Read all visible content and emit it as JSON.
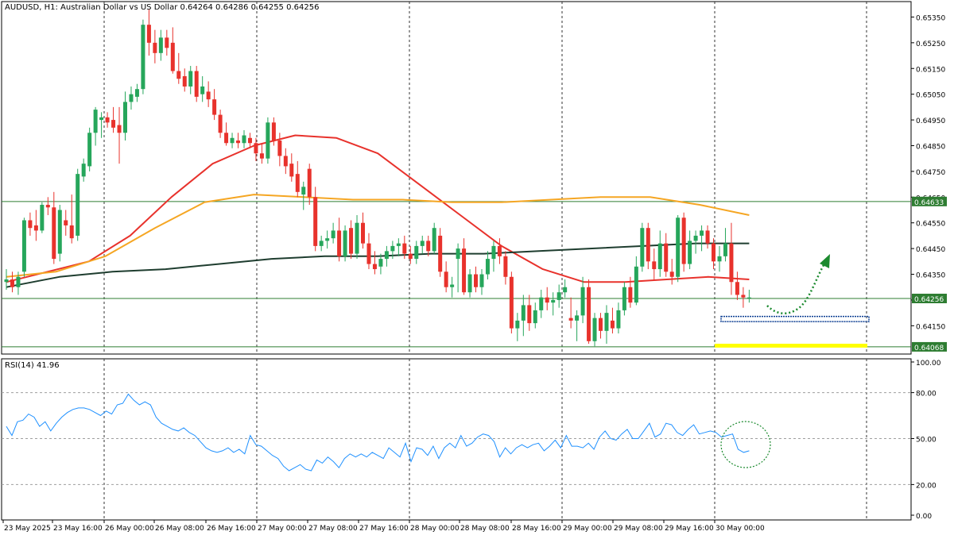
{
  "header": {
    "symbol_line": "AUDUSD, H1:  Australian Dollar vs US Dollar  0.64264 0.64286 0.64255 0.64256"
  },
  "rsi_panel": {
    "title": "RSI(14) 41.96"
  },
  "colors": {
    "bull": "#26a65b",
    "bear": "#e8322c",
    "ma_red": "#e8322c",
    "ma_orange": "#f5a623",
    "ma_dark": "#1e3d2f",
    "level_line": "#2e7d32",
    "rsi_line": "#1e90ff",
    "highlight": "#ffff00",
    "arrow": "#1b8a2e",
    "grid": "#9e9e9e"
  },
  "chart_data": [
    {
      "type": "candlestick",
      "title": "AUDUSD, H1:  Australian Dollar vs US Dollar  0.64264 0.64286 0.64255 0.64256",
      "ylim": [
        0.6404,
        0.6541
      ],
      "y_ticks": [
        "0.65350",
        "0.65250",
        "0.65150",
        "0.65050",
        "0.64950",
        "0.64850",
        "0.64750",
        "0.64650",
        "0.64550",
        "0.64450",
        "0.64350",
        "0.64250",
        "0.64150"
      ],
      "x_tick_labels": [
        "23 May 2025",
        "23 May 16:00",
        "26 May 00:00",
        "26 May 08:00",
        "26 May 16:00",
        "27 May 00:00",
        "27 May 08:00",
        "27 May 16:00",
        "28 May 00:00",
        "28 May 08:00",
        "28 May 16:00",
        "29 May 00:00",
        "29 May 08:00",
        "29 May 16:00",
        "30 May 00:00"
      ],
      "price_labels": [
        {
          "value": "0.64633",
          "color": "#2e7d32"
        },
        {
          "value": "0.64256",
          "color": "#2e7d32"
        },
        {
          "value": "0.64068",
          "color": "#2e7d32"
        }
      ],
      "horizontal_levels": [
        0.64633,
        0.64256,
        0.64068
      ],
      "period_separators": [
        "26 May 00:00",
        "27 May 00:00",
        "28 May 00:00",
        "29 May 00:00",
        "30 May 00:00",
        "31 May 00:00"
      ],
      "ohlc": [
        [
          0.6432,
          0.6437,
          0.6429,
          0.6433
        ],
        [
          0.6433,
          0.6436,
          0.6428,
          0.643
        ],
        [
          0.643,
          0.6436,
          0.6427,
          0.6434
        ],
        [
          0.6436,
          0.6457,
          0.6434,
          0.6456
        ],
        [
          0.6456,
          0.6459,
          0.645,
          0.6453
        ],
        [
          0.6454,
          0.646,
          0.6448,
          0.6452
        ],
        [
          0.6452,
          0.6463,
          0.6451,
          0.6462
        ],
        [
          0.6462,
          0.6465,
          0.6458,
          0.6461
        ],
        [
          0.6461,
          0.6467,
          0.6439,
          0.6441
        ],
        [
          0.6443,
          0.6462,
          0.644,
          0.646
        ],
        [
          0.6456,
          0.646,
          0.645,
          0.6454
        ],
        [
          0.6454,
          0.6466,
          0.6447,
          0.6449
        ],
        [
          0.645,
          0.6476,
          0.6448,
          0.6474
        ],
        [
          0.6473,
          0.648,
          0.6471,
          0.6478
        ],
        [
          0.6477,
          0.6492,
          0.6475,
          0.649
        ],
        [
          0.649,
          0.65,
          0.6485,
          0.6499
        ],
        [
          0.6495,
          0.6498,
          0.6488,
          0.6496
        ],
        [
          0.6496,
          0.6498,
          0.6492,
          0.6494
        ],
        [
          0.6495,
          0.65,
          0.649,
          0.6492
        ],
        [
          0.6493,
          0.65,
          0.6478,
          0.649
        ],
        [
          0.649,
          0.6506,
          0.6487,
          0.6502
        ],
        [
          0.6502,
          0.6508,
          0.6499,
          0.6505
        ],
        [
          0.6504,
          0.6509,
          0.6502,
          0.6507
        ],
        [
          0.6507,
          0.6534,
          0.6505,
          0.6532
        ],
        [
          0.6532,
          0.6538,
          0.652,
          0.6525
        ],
        [
          0.6525,
          0.653,
          0.6517,
          0.6521
        ],
        [
          0.6521,
          0.653,
          0.6518,
          0.6527
        ],
        [
          0.6527,
          0.653,
          0.652,
          0.6523
        ],
        [
          0.6525,
          0.6531,
          0.6513,
          0.6514
        ],
        [
          0.6514,
          0.6521,
          0.6509,
          0.6511
        ],
        [
          0.6512,
          0.6515,
          0.6506,
          0.6508
        ],
        [
          0.6508,
          0.6516,
          0.6505,
          0.6514
        ],
        [
          0.6514,
          0.6516,
          0.6502,
          0.6504
        ],
        [
          0.6505,
          0.6512,
          0.6502,
          0.6508
        ],
        [
          0.6506,
          0.651,
          0.65,
          0.6503
        ],
        [
          0.6503,
          0.6507,
          0.6495,
          0.6497
        ],
        [
          0.6497,
          0.6499,
          0.6488,
          0.649
        ],
        [
          0.649,
          0.6494,
          0.6485,
          0.6486
        ],
        [
          0.6486,
          0.649,
          0.6484,
          0.6488
        ],
        [
          0.6487,
          0.649,
          0.6484,
          0.6486
        ],
        [
          0.6486,
          0.6491,
          0.6484,
          0.6489
        ],
        [
          0.6488,
          0.649,
          0.6484,
          0.6486
        ],
        [
          0.6486,
          0.6488,
          0.6479,
          0.6482
        ],
        [
          0.6482,
          0.6486,
          0.6478,
          0.648
        ],
        [
          0.648,
          0.6496,
          0.6478,
          0.6494
        ],
        [
          0.6494,
          0.6496,
          0.6485,
          0.6487
        ],
        [
          0.6487,
          0.649,
          0.6477,
          0.6481
        ],
        [
          0.6481,
          0.6484,
          0.6474,
          0.6477
        ],
        [
          0.6478,
          0.6482,
          0.6471,
          0.6473
        ],
        [
          0.6474,
          0.6479,
          0.6465,
          0.6467
        ],
        [
          0.6466,
          0.6471,
          0.646,
          0.6469
        ],
        [
          0.6476,
          0.6478,
          0.6462,
          0.6465
        ],
        [
          0.6465,
          0.6469,
          0.6444,
          0.6446
        ],
        [
          0.6446,
          0.645,
          0.6444,
          0.6448
        ],
        [
          0.6448,
          0.6452,
          0.6445,
          0.6449
        ],
        [
          0.6449,
          0.6455,
          0.6447,
          0.6452
        ],
        [
          0.6452,
          0.6457,
          0.644,
          0.6442
        ],
        [
          0.6442,
          0.6454,
          0.644,
          0.6452
        ],
        [
          0.6453,
          0.6456,
          0.6441,
          0.6443
        ],
        [
          0.6443,
          0.6458,
          0.6441,
          0.6455
        ],
        [
          0.6455,
          0.6459,
          0.6445,
          0.6447
        ],
        [
          0.6447,
          0.6451,
          0.6437,
          0.6439
        ],
        [
          0.6439,
          0.6444,
          0.6435,
          0.6437
        ],
        [
          0.6438,
          0.6443,
          0.6435,
          0.6441
        ],
        [
          0.6441,
          0.6446,
          0.6438,
          0.6444
        ],
        [
          0.6444,
          0.6448,
          0.6441,
          0.6446
        ],
        [
          0.6446,
          0.6449,
          0.6442,
          0.6447
        ],
        [
          0.6447,
          0.645,
          0.6441,
          0.6443
        ],
        [
          0.6443,
          0.6446,
          0.6439,
          0.6441
        ],
        [
          0.6441,
          0.6448,
          0.6439,
          0.6446
        ],
        [
          0.6446,
          0.645,
          0.6443,
          0.6448
        ],
        [
          0.6448,
          0.645,
          0.6442,
          0.6444
        ],
        [
          0.6444,
          0.6455,
          0.6443,
          0.6453
        ],
        [
          0.645,
          0.6453,
          0.6434,
          0.6436
        ],
        [
          0.6436,
          0.644,
          0.6428,
          0.643
        ],
        [
          0.643,
          0.6434,
          0.6426,
          0.6431
        ],
        [
          0.6441,
          0.6447,
          0.6428,
          0.6445
        ],
        [
          0.6445,
          0.6449,
          0.6427,
          0.6428
        ],
        [
          0.6428,
          0.6437,
          0.6426,
          0.6435
        ],
        [
          0.6435,
          0.6438,
          0.6428,
          0.643
        ],
        [
          0.643,
          0.6437,
          0.6427,
          0.6435
        ],
        [
          0.6435,
          0.6444,
          0.6433,
          0.6441
        ],
        [
          0.6441,
          0.6448,
          0.6436,
          0.6446
        ],
        [
          0.6446,
          0.6449,
          0.6439,
          0.6442
        ],
        [
          0.6442,
          0.6444,
          0.6431,
          0.6434
        ],
        [
          0.6434,
          0.6436,
          0.6412,
          0.6414
        ],
        [
          0.6414,
          0.642,
          0.6409,
          0.6417
        ],
        [
          0.6417,
          0.6427,
          0.6411,
          0.6423
        ],
        [
          0.6423,
          0.6427,
          0.6413,
          0.6416
        ],
        [
          0.6416,
          0.6424,
          0.6414,
          0.6421
        ],
        [
          0.6421,
          0.6429,
          0.6418,
          0.6426
        ],
        [
          0.6426,
          0.643,
          0.6421,
          0.6424
        ],
        [
          0.6424,
          0.6428,
          0.6419,
          0.6425
        ],
        [
          0.6425,
          0.6431,
          0.6422,
          0.6428
        ],
        [
          0.6428,
          0.6433,
          0.6426,
          0.643
        ],
        [
          0.6418,
          0.6426,
          0.6414,
          0.6417
        ],
        [
          0.6417,
          0.6421,
          0.6409,
          0.6419
        ],
        [
          0.6419,
          0.6434,
          0.6416,
          0.643
        ],
        [
          0.643,
          0.6433,
          0.6408,
          0.6409
        ],
        [
          0.6409,
          0.642,
          0.6407,
          0.6418
        ],
        [
          0.6418,
          0.642,
          0.641,
          0.6413
        ],
        [
          0.6413,
          0.6423,
          0.6408,
          0.642
        ],
        [
          0.6417,
          0.6422,
          0.6412,
          0.6414
        ],
        [
          0.6414,
          0.6424,
          0.6412,
          0.6421
        ],
        [
          0.6421,
          0.6432,
          0.6419,
          0.643
        ],
        [
          0.643,
          0.6434,
          0.6422,
          0.6424
        ],
        [
          0.6424,
          0.6442,
          0.6423,
          0.6438
        ],
        [
          0.6438,
          0.6455,
          0.6436,
          0.6453
        ],
        [
          0.6453,
          0.6455,
          0.6437,
          0.644
        ],
        [
          0.644,
          0.6445,
          0.6433,
          0.6437
        ],
        [
          0.6437,
          0.6452,
          0.6434,
          0.6447
        ],
        [
          0.6447,
          0.6451,
          0.6434,
          0.6436
        ],
        [
          0.6436,
          0.6441,
          0.6431,
          0.6434
        ],
        [
          0.6434,
          0.6458,
          0.6432,
          0.6457
        ],
        [
          0.6457,
          0.6459,
          0.6436,
          0.6439
        ],
        [
          0.6439,
          0.6452,
          0.6437,
          0.6448
        ],
        [
          0.6448,
          0.6452,
          0.6443,
          0.645
        ],
        [
          0.645,
          0.6454,
          0.6444,
          0.6452
        ],
        [
          0.6452,
          0.6454,
          0.6445,
          0.6447
        ],
        [
          0.6447,
          0.6449,
          0.6437,
          0.644
        ],
        [
          0.644,
          0.6446,
          0.6436,
          0.6442
        ],
        [
          0.6442,
          0.6453,
          0.644,
          0.6447
        ],
        [
          0.6447,
          0.6455,
          0.6427,
          0.6432
        ],
        [
          0.6432,
          0.6436,
          0.6425,
          0.6427
        ],
        [
          0.6427,
          0.643,
          0.6422,
          0.6426
        ],
        [
          0.6426,
          0.6429,
          0.6424,
          0.6426
        ]
      ],
      "overlay_lines": [
        {
          "color": "#e8322c",
          "values": [
            0.6432,
            0.6436,
            0.644,
            0.645,
            0.6465,
            0.6478,
            0.6485,
            0.6489,
            0.6488,
            0.6482,
            0.647,
            0.6458,
            0.6446,
            0.6437,
            0.6432,
            0.6432,
            0.6433,
            0.6434,
            0.6433
          ]
        },
        {
          "color": "#f5a623",
          "values": [
            0.6434,
            0.6436,
            0.6442,
            0.6453,
            0.6463,
            0.6466,
            0.6465,
            0.6464,
            0.6464,
            0.6463,
            0.6463,
            0.6464,
            0.6465,
            0.6465,
            0.6462,
            0.6458
          ]
        },
        {
          "color": "#1e3d2f",
          "values": [
            0.643,
            0.6434,
            0.6436,
            0.6437,
            0.6439,
            0.6441,
            0.6442,
            0.6442,
            0.6443,
            0.6443,
            0.6444,
            0.6445,
            0.6446,
            0.6447,
            0.6447
          ]
        }
      ],
      "forecast_arrow": "up",
      "zones": [
        {
          "type": "dotted-box",
          "color": "#0b3d91",
          "low": 0.64166,
          "high": 0.64186
        },
        {
          "type": "highlight",
          "color": "#ffff00",
          "low": 0.64065,
          "high": 0.6408
        }
      ]
    },
    {
      "type": "line",
      "title": "RSI(14) 41.96",
      "ylim": [
        0,
        100
      ],
      "y_ticks": [
        "100.00",
        "80.00",
        "50.00",
        "20.00",
        "0.00"
      ],
      "levels": [
        80,
        50,
        20
      ],
      "series": [
        {
          "values": [
            58,
            52,
            61,
            62,
            66,
            64,
            58,
            61,
            55,
            60,
            64,
            67,
            69,
            70,
            70,
            69,
            67,
            65,
            68,
            66,
            72,
            73,
            79,
            75,
            72,
            74,
            72,
            64,
            60,
            58,
            56,
            55,
            57,
            54,
            52,
            48,
            44,
            42,
            41,
            42,
            44,
            41,
            43,
            40,
            52,
            46,
            45,
            42,
            39,
            37,
            32,
            29,
            31,
            33,
            30,
            29,
            36,
            34,
            38,
            35,
            31,
            37,
            40,
            38,
            40,
            38,
            41,
            39,
            37,
            44,
            41,
            38,
            47,
            35,
            44,
            43,
            39,
            45,
            37,
            44,
            47,
            44,
            52,
            45,
            47,
            51,
            53,
            52,
            48,
            38,
            44,
            40,
            44,
            46,
            44,
            46,
            47,
            42,
            45,
            49,
            44,
            52,
            45,
            45,
            44,
            47,
            43,
            51,
            55,
            50,
            49,
            53,
            56,
            50,
            50,
            55,
            60,
            51,
            53,
            60,
            59,
            54,
            52,
            56,
            59,
            53,
            54,
            55,
            54,
            51,
            52,
            53,
            43,
            41,
            42
          ]
        }
      ],
      "annotation": "dotted-circle"
    }
  ]
}
